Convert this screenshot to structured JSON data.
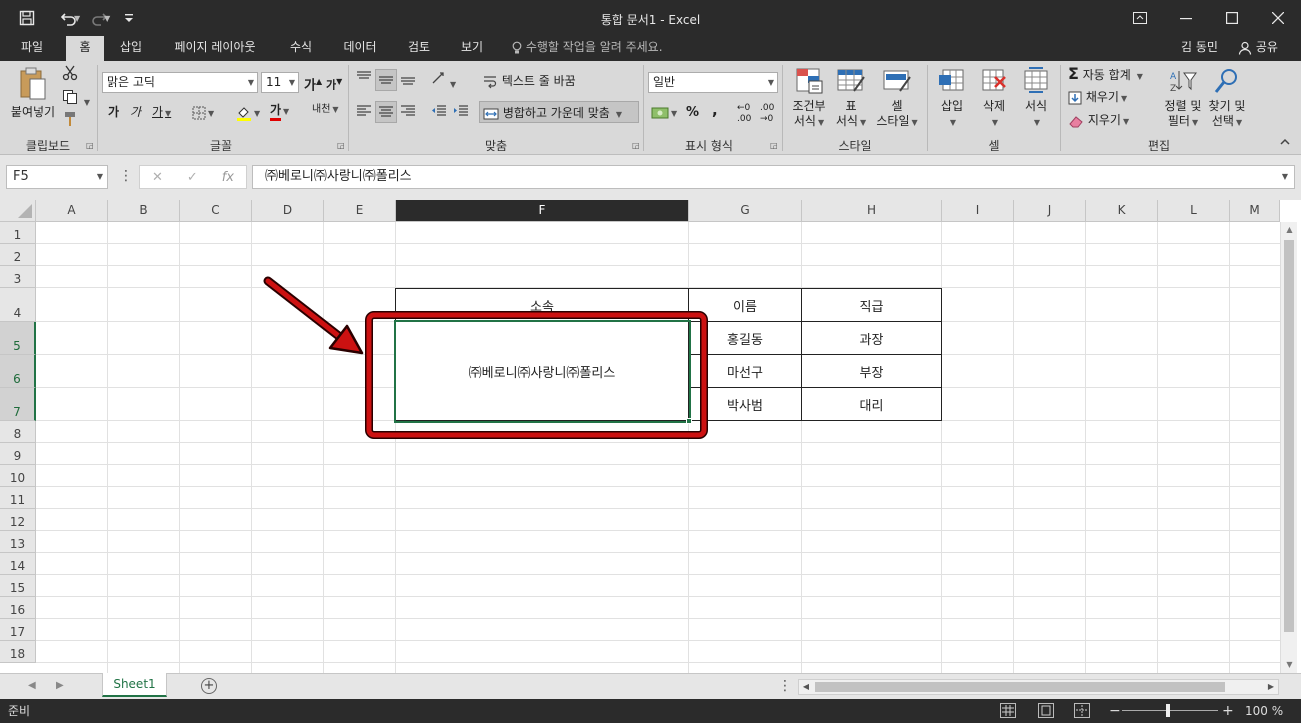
{
  "window": {
    "title": "통합 문서1 - Excel"
  },
  "qat": {
    "save_icon": "save-icon",
    "undo_icon": "undo-icon",
    "redo_icon": "redo-icon",
    "customize_icon": "customize-qat-icon"
  },
  "tabs": [
    {
      "label": "파일"
    },
    {
      "label": "홈"
    },
    {
      "label": "삽입"
    },
    {
      "label": "페이지 레이아웃"
    },
    {
      "label": "수식"
    },
    {
      "label": "데이터"
    },
    {
      "label": "검토"
    },
    {
      "label": "보기"
    }
  ],
  "tell_me": "수행할 작업을 알려 주세요.",
  "user_name": "김 동민",
  "share_label": "공유",
  "ribbon": {
    "clipboard": {
      "paste": "붙여넣기",
      "label": "클립보드"
    },
    "font": {
      "font_name": "맑은 고딕",
      "font_size": "11",
      "grow": "가",
      "shrink": "가",
      "bold": "가",
      "italic": "가",
      "underline": "가",
      "font_color_glyph": "가",
      "phonetic": "내천",
      "label": "글꼴"
    },
    "alignment": {
      "wrap_text": "텍스트 줄 바꿈",
      "merge_center": "병합하고 가운데 맞춤",
      "label": "맞춤"
    },
    "number": {
      "format": "일반",
      "percent": "%",
      "comma": ",",
      "inc_decimal": ".00",
      "dec_decimal": ".00",
      "label": "표시 형식"
    },
    "styles": {
      "conditional_1": "조건부",
      "conditional_2": "서식",
      "table_1": "표",
      "table_2": "서식",
      "cell_1": "셀",
      "cell_2": "스타일",
      "label": "스타일"
    },
    "cells": {
      "insert": "삽입",
      "delete": "삭제",
      "format": "서식",
      "label": "셀"
    },
    "editing": {
      "autosum": "자동 합계",
      "fill": "채우기",
      "clear": "지우기",
      "sort_1": "정렬 및",
      "sort_2": "필터",
      "find_1": "찾기 및",
      "find_2": "선택",
      "label": "편집"
    }
  },
  "formula_bar": {
    "name_box": "F5",
    "formula": "㈜베로니㈜사랑니㈜폴리스",
    "cancel": "✕",
    "enter": "✓",
    "fx": "fx"
  },
  "columns": [
    "A",
    "B",
    "C",
    "D",
    "E",
    "F",
    "G",
    "H",
    "I",
    "J",
    "K",
    "L",
    "M"
  ],
  "rows": [
    "1",
    "2",
    "3",
    "4",
    "5",
    "6",
    "7",
    "8",
    "9",
    "10",
    "11",
    "12",
    "13",
    "14",
    "15",
    "16",
    "17",
    "18"
  ],
  "selected": {
    "column": "F",
    "rows": [
      "5",
      "6",
      "7"
    ]
  },
  "table": {
    "headers": [
      "소속",
      "이름",
      "직급"
    ],
    "merged_value": "㈜베로니㈜사랑니㈜폴리스",
    "names": [
      "홍길동",
      "마선구",
      "박사범"
    ],
    "titles": [
      "과장",
      "부장",
      "대리"
    ]
  },
  "sheet_tabs": [
    "Sheet1"
  ],
  "status": {
    "ready": "준비",
    "zoom": "100 %",
    "zoom_minus": "−",
    "zoom_plus": "+"
  },
  "colors": {
    "excel_green": "#217346",
    "annotation_red": "#cc1111"
  }
}
